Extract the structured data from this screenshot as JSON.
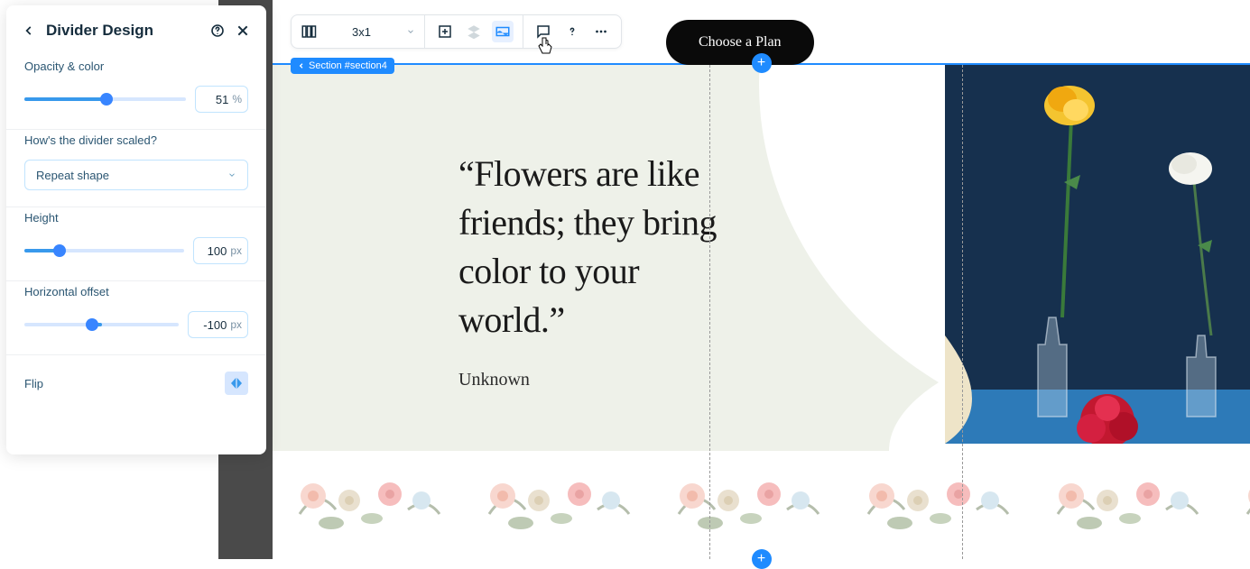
{
  "panel": {
    "title": "Divider Design",
    "opacity": {
      "label": "Opacity & color",
      "value": "51",
      "unit": "%"
    },
    "scale": {
      "label": "How's the divider scaled?",
      "selected": "Repeat shape"
    },
    "height": {
      "label": "Height",
      "value": "100",
      "unit": "px"
    },
    "offset": {
      "label": "Horizontal offset",
      "value": "-100",
      "unit": "px"
    },
    "flip": {
      "label": "Flip"
    }
  },
  "toolbar": {
    "layout_label": "3x1"
  },
  "plan_button": "Choose a Plan",
  "section_tag": "Section #section4",
  "content": {
    "quote": "“Flowers are like friends; they bring color to your world.”",
    "author": "Unknown"
  }
}
